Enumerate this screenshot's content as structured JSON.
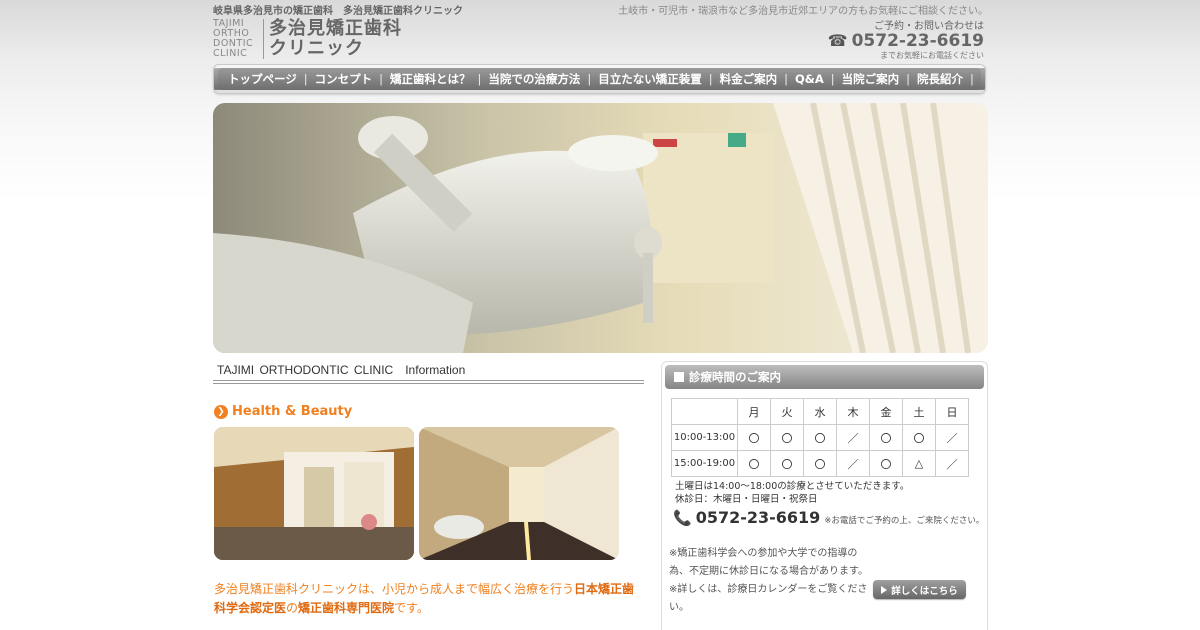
{
  "header": {
    "region_label": "岐阜県多治見市の矯正歯科",
    "clinic_label": "多治見矯正歯科クリニック",
    "tagline": "土岐市・可児市・瑞浪市など多治見市近郊エリアの方もお気軽にご相談ください。",
    "logo_mark": "TAJIMI ORTHO DONTIC CLINIC",
    "logo_line1": "多治見矯正歯科",
    "logo_line2": "クリニック",
    "contact_label": "ご予約・お問い合わせは",
    "phone": "0572-23-6619",
    "contact_note": "までお気軽にお電話ください"
  },
  "nav": {
    "items": [
      {
        "label": "トップページ"
      },
      {
        "label": "コンセプト"
      },
      {
        "label": "矯正歯科とは？"
      },
      {
        "label": "当院での治療方法"
      },
      {
        "label": "目立たない矯正装置"
      },
      {
        "label": "料金ご案内"
      },
      {
        "label": "Q&A"
      },
      {
        "label": "当院ご案内"
      },
      {
        "label": "院長紹介"
      }
    ]
  },
  "info": {
    "title": "TAJIMI ORTHODONTIC CLINIC　Information",
    "section_title": "Health & Beauty",
    "desc_pre": "多治見矯正歯科クリニックは、小児から成人まで幅広く治療を行う",
    "desc_bold1": "日本矯正歯科学会認定医",
    "desc_mid": "の",
    "desc_bold2": "矯正歯科専門医院",
    "desc_post": "です。"
  },
  "schedule": {
    "title": "診療時間のご案内",
    "days": [
      "月",
      "火",
      "水",
      "木",
      "金",
      "土",
      "日"
    ],
    "rows": [
      {
        "time": "10:00-13:00",
        "marks": [
          "〇",
          "〇",
          "〇",
          "／",
          "〇",
          "〇",
          "／"
        ]
      },
      {
        "time": "15:00-19:00",
        "marks": [
          "〇",
          "〇",
          "〇",
          "／",
          "〇",
          "△",
          "／"
        ]
      }
    ],
    "note_saturday": "土曜日は14:00〜18:00の診療とさせていただきます。",
    "note_closed": "休診日：木曜日・日曜日・祝祭日",
    "phone": "0572-23-6619",
    "phone_note": "※お電話でご予約の上、ご来院ください。",
    "irregular_note": "※矯正歯科学会への参加や大学での指導の為、不定期に休診日になる場合があります。",
    "calendar_note": "※詳しくは、診療日カレンダーをご覧ください。",
    "more_label": "詳しくはこちら"
  },
  "colors": {
    "accent": "#f08020",
    "nav_gray": "#808080"
  }
}
